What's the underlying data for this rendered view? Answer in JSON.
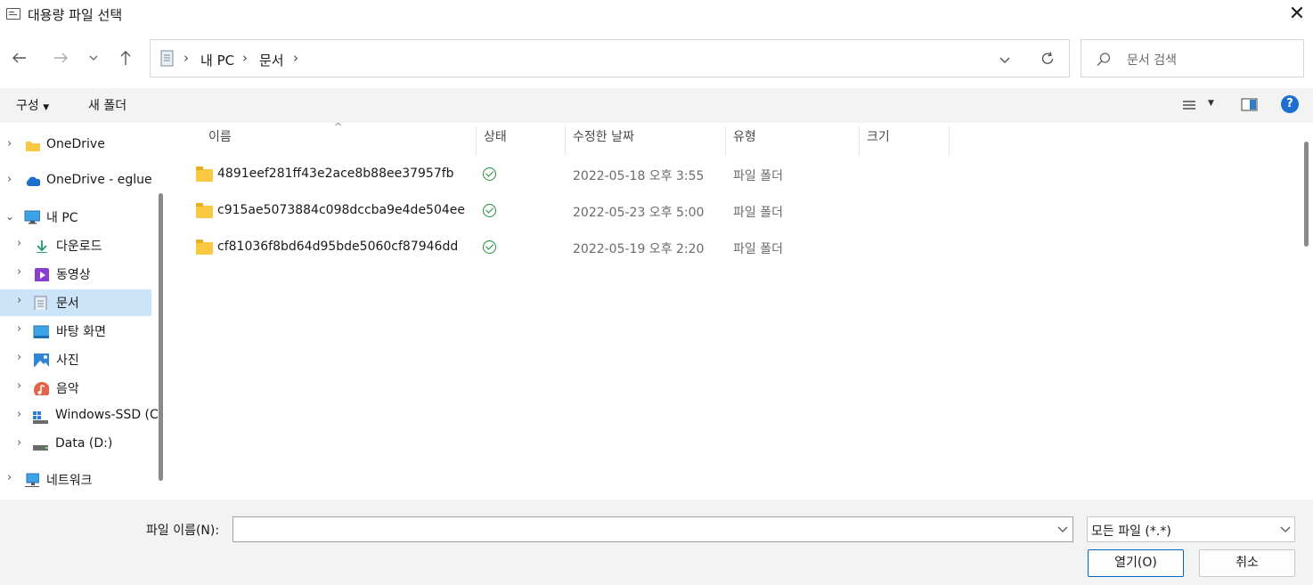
{
  "window": {
    "title": "대용량 파일 선택"
  },
  "address": {
    "crumbs": [
      "내 PC",
      "문서"
    ]
  },
  "search": {
    "placeholder": "문서 검색"
  },
  "toolbar": {
    "organize_label": "구성",
    "new_folder_label": "새 폴더"
  },
  "sidebar": {
    "items": [
      {
        "label": "OneDrive",
        "icon": "folder-icon"
      },
      {
        "label": "OneDrive - eglue",
        "icon": "cloud-icon"
      },
      {
        "label": "내 PC",
        "icon": "computer-icon"
      },
      {
        "label": "다운로드",
        "icon": "download-icon"
      },
      {
        "label": "동영상",
        "icon": "video-icon"
      },
      {
        "label": "문서",
        "icon": "document-icon",
        "selected": true
      },
      {
        "label": "바탕 화면",
        "icon": "desktop-icon"
      },
      {
        "label": "사진",
        "icon": "pictures-icon"
      },
      {
        "label": "음악",
        "icon": "music-icon"
      },
      {
        "label": "Windows-SSD (C",
        "icon": "drive-icon"
      },
      {
        "label": "Data (D:)",
        "icon": "drive-icon"
      },
      {
        "label": "네트워크",
        "icon": "network-icon"
      }
    ]
  },
  "list": {
    "columns": [
      "이름",
      "상태",
      "수정한 날짜",
      "유형",
      "크기"
    ],
    "rows": [
      {
        "name": "4891eef281ff43e2ace8b88ee37957fb",
        "status": "synced",
        "date": "2022-05-18 오후 3:55",
        "type": "파일 폴더"
      },
      {
        "name": "c915ae5073884c098dccba9e4de504ee",
        "status": "synced",
        "date": "2022-05-23 오후 5:00",
        "type": "파일 폴더"
      },
      {
        "name": "cf81036f8bd64d95bde5060cf87946dd",
        "status": "synced",
        "date": "2022-05-19 오후 2:20",
        "type": "파일 폴더"
      }
    ]
  },
  "footer": {
    "filename_label": "파일 이름(N):",
    "filename_value": "",
    "filetype_selected": "모든 파일 (*.*)",
    "open_label": "열기(O)",
    "cancel_label": "취소"
  },
  "colors": {
    "accent": "#0067c0",
    "selection": "#cce4f7",
    "status_ok": "#1e8f3a",
    "folder": "#f8c841"
  }
}
